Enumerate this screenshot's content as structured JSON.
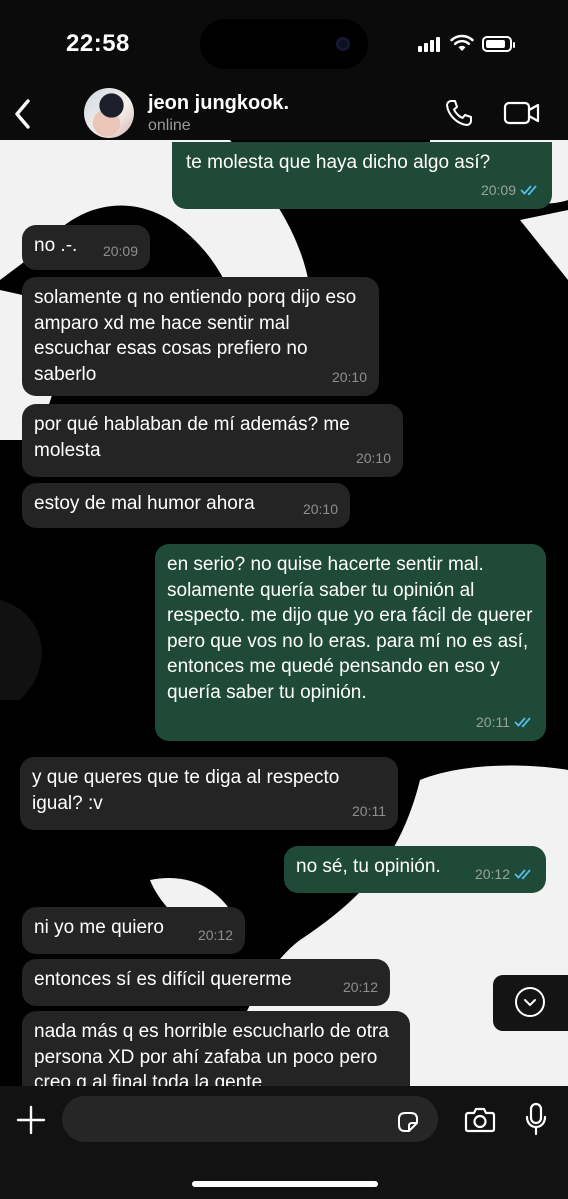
{
  "status_bar": {
    "time": "22:58",
    "battery_fraction": 0.85
  },
  "header": {
    "name": "jeon jungkook.",
    "status": "online"
  },
  "messages": [
    {
      "dir": "out",
      "text": "te molesta que haya dicho algo así?",
      "time": "20:09"
    },
    {
      "dir": "in",
      "text": "no .-.",
      "time": "20:09"
    },
    {
      "dir": "in",
      "text": "solamente q no entiendo porq dijo eso amparo xd me hace sentir mal escuchar esas cosas prefiero no saberlo",
      "time": "20:10"
    },
    {
      "dir": "in",
      "text": "por qué hablaban de mí además? me molesta",
      "time": "20:10"
    },
    {
      "dir": "in",
      "text": "estoy de mal humor ahora",
      "time": "20:10"
    },
    {
      "dir": "out",
      "text": "en serio? no quise hacerte sentir mal. solamente quería saber tu opinión al respecto. me dijo que yo era fácil de querer pero que vos no lo eras. para mí no es así, entonces me quedé pensando en eso y quería saber tu opinión.",
      "time": "20:11"
    },
    {
      "dir": "in",
      "text": "y que queres que te diga al respecto igual? :v",
      "time": "20:11"
    },
    {
      "dir": "out",
      "text": "no sé, tu opinión.",
      "time": "20:12"
    },
    {
      "dir": "in",
      "text": "ni yo me quiero",
      "time": "20:12"
    },
    {
      "dir": "in",
      "text": "entonces sí es difícil quererme",
      "time": "20:12"
    },
    {
      "dir": "in",
      "text": "nada más q es horrible escucharlo de otra persona XD por ahí zafaba un poco pero creo q al final toda la gente",
      "time": ""
    }
  ],
  "composer": {
    "placeholder": ""
  },
  "colors": {
    "outgoing": "#1f4a37",
    "incoming": "#242424",
    "read_ticks": "#53bdeb"
  },
  "icons": [
    "back-icon",
    "phone-icon",
    "video-icon",
    "chevron-down-icon",
    "plus-icon",
    "sticker-icon",
    "camera-icon",
    "mic-icon"
  ]
}
